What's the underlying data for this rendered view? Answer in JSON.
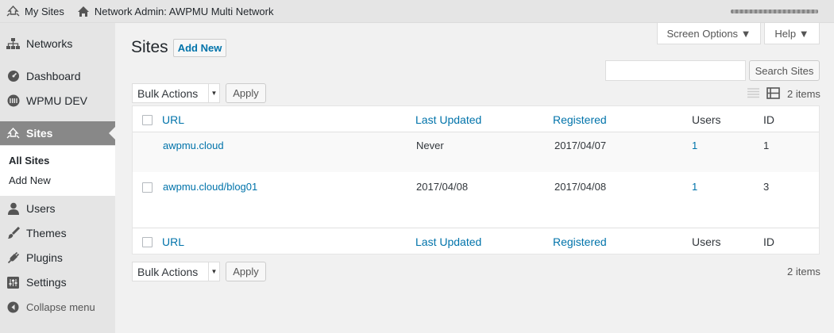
{
  "adminbar": {
    "my_sites": "My Sites",
    "network_admin": "Network Admin: AWPMU Multi Network"
  },
  "sidebar": {
    "items": [
      {
        "label": "Networks",
        "icon": "sitemap-icon"
      },
      {
        "label": "Dashboard",
        "icon": "dashboard-icon"
      },
      {
        "label": "WPMU DEV",
        "icon": "wpmudev-icon"
      },
      {
        "label": "Sites",
        "icon": "sites-icon"
      },
      {
        "label": "Users",
        "icon": "user-icon"
      },
      {
        "label": "Themes",
        "icon": "brush-icon"
      },
      {
        "label": "Plugins",
        "icon": "plug-icon"
      },
      {
        "label": "Settings",
        "icon": "settings-icon"
      }
    ],
    "submenu": [
      "All Sites",
      "Add New"
    ],
    "collapse": "Collapse menu"
  },
  "top_buttons": {
    "screen_options": "Screen Options ▼",
    "help": "Help ▼"
  },
  "page": {
    "title": "Sites",
    "add_new": "Add New",
    "search_button": "Search Sites",
    "bulk_actions": "Bulk Actions",
    "apply": "Apply",
    "items_count": "2 items"
  },
  "table": {
    "columns": [
      "URL",
      "Last Updated",
      "Registered",
      "Users",
      "ID"
    ],
    "rows": [
      {
        "url": "awpmu.cloud",
        "last_updated": "Never",
        "registered": "2017/04/07",
        "users": "1",
        "id": "1"
      },
      {
        "url": "awpmu.cloud/blog01",
        "last_updated": "2017/04/08",
        "registered": "2017/04/08",
        "users": "1",
        "id": "3"
      }
    ]
  },
  "colors": {
    "link": "#0073aa",
    "current_menu": "#888888",
    "adminbar": "#e5e5e5"
  }
}
